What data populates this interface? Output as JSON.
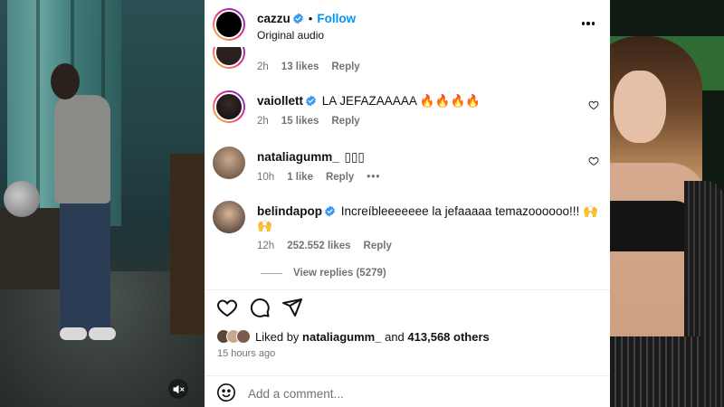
{
  "post": {
    "author": "cazzu",
    "follow_label": "Follow",
    "separator": "•",
    "audio": "Original audio"
  },
  "comments": [
    {
      "username": "",
      "text": "",
      "time": "2h",
      "likes": "13 likes",
      "reply": "Reply"
    },
    {
      "username": "vaiollett",
      "text": "LA JEFAZAAAAA 🔥🔥🔥🔥",
      "time": "2h",
      "likes": "15 likes",
      "reply": "Reply"
    },
    {
      "username": "nataliagumm_",
      "text": "▯▯▯",
      "time": "10h",
      "likes": "1 like",
      "reply": "Reply",
      "more": "•••"
    },
    {
      "username": "belindapop",
      "text_line1": "Increíbleeeeeee la jefaaaaa temazoooooo!!! 🙌",
      "text_line2": "🙌",
      "time": "12h",
      "likes": "252.552 likes",
      "reply": "Reply"
    }
  ],
  "view_replies": "View replies (5279)",
  "likes_summary": {
    "prefix": "Liked by",
    "user": "nataliagumm_",
    "and": "and",
    "count": "413,568 others"
  },
  "posted": "15 hours ago",
  "add_comment": {
    "placeholder": "Add a comment..."
  },
  "colors": {
    "accent_blue": "#0095f6",
    "muted_text": "#737373",
    "verified_blue": "#3897f0"
  },
  "icons": [
    "verified-icon",
    "more-icon",
    "heart-icon",
    "comment-icon",
    "share-icon",
    "emoji-icon",
    "mute-icon"
  ]
}
